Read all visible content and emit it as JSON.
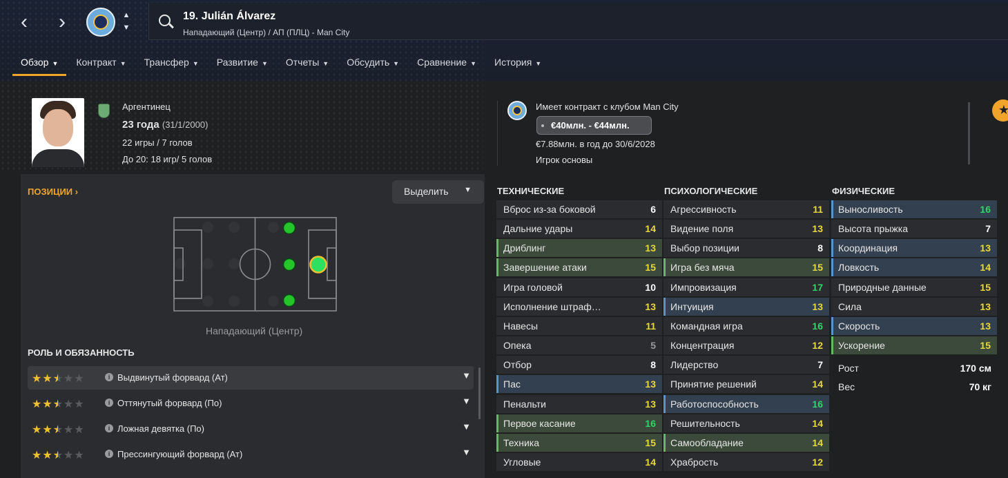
{
  "player": {
    "title": "19. Julián Álvarez",
    "subtitle": "Нападающий (Центр) / АП (ПЛЦ) - Man City"
  },
  "tabs": [
    {
      "label": "Обзор"
    },
    {
      "label": "Контракт"
    },
    {
      "label": "Трансфер"
    },
    {
      "label": "Развитие"
    },
    {
      "label": "Отчеты"
    },
    {
      "label": "Обсудить"
    },
    {
      "label": "Сравнение"
    },
    {
      "label": "История"
    }
  ],
  "info": {
    "nationality": "Аргентинец",
    "age": "23 года",
    "dob": "(31/1/2000)",
    "games": "22 игры / 7 голов",
    "u20": "До 20: 18 игр/ 5 голов"
  },
  "contract": {
    "status": "Имеет контракт с клубом Man City",
    "value": "€40млн. - €44млн.",
    "wage": "€7.88млн. в год до 30/6/2028",
    "role": "Игрок основы"
  },
  "positions": {
    "title": "ПОЗИЦИИ",
    "highlight_label": "Выделить",
    "position_label": "Нападающий (Центр)"
  },
  "roles": {
    "title": "РОЛЬ И ОБЯЗАННОСТЬ",
    "items": [
      {
        "name": "Выдвинутый форвард (Ат)",
        "rating": 2.5
      },
      {
        "name": "Оттянутый форвард (По)",
        "rating": 2.5
      },
      {
        "name": "Ложная девятка (По)",
        "rating": 2.5
      },
      {
        "name": "Прессингующий форвард (Ат)",
        "rating": 2.5
      }
    ]
  },
  "attributes": {
    "technical": {
      "title": "ТЕХНИЧЕСКИЕ",
      "items": [
        {
          "name": "Вброс из-за боковой",
          "value": "6"
        },
        {
          "name": "Дальние удары",
          "value": "14"
        },
        {
          "name": "Дриблинг",
          "value": "13"
        },
        {
          "name": "Завершение атаки",
          "value": "15"
        },
        {
          "name": "Игра головой",
          "value": "10"
        },
        {
          "name": "Исполнение штраф…",
          "value": "13"
        },
        {
          "name": "Навесы",
          "value": "11"
        },
        {
          "name": "Опека",
          "value": "5"
        },
        {
          "name": "Отбор",
          "value": "8"
        },
        {
          "name": "Пас",
          "value": "13"
        },
        {
          "name": "Пенальти",
          "value": "13"
        },
        {
          "name": "Первое касание",
          "value": "16"
        },
        {
          "name": "Техника",
          "value": "15"
        },
        {
          "name": "Угловые",
          "value": "14"
        }
      ]
    },
    "mental": {
      "title": "ПСИХОЛОГИЧЕСКИЕ",
      "items": [
        {
          "name": "Агрессивность",
          "value": "11"
        },
        {
          "name": "Видение поля",
          "value": "13"
        },
        {
          "name": "Выбор позиции",
          "value": "8"
        },
        {
          "name": "Игра без мяча",
          "value": "15"
        },
        {
          "name": "Импровизация",
          "value": "17"
        },
        {
          "name": "Интуиция",
          "value": "13"
        },
        {
          "name": "Командная игра",
          "value": "16"
        },
        {
          "name": "Концентрация",
          "value": "12"
        },
        {
          "name": "Лидерство",
          "value": "7"
        },
        {
          "name": "Принятие решений",
          "value": "14"
        },
        {
          "name": "Работоспособность",
          "value": "16"
        },
        {
          "name": "Решительность",
          "value": "14"
        },
        {
          "name": "Самообладание",
          "value": "14"
        },
        {
          "name": "Храбрость",
          "value": "12"
        }
      ]
    },
    "physical": {
      "title": "ФИЗИЧЕСКИЕ",
      "items": [
        {
          "name": "Выносливость",
          "value": "16"
        },
        {
          "name": "Высота прыжка",
          "value": "7"
        },
        {
          "name": "Координация",
          "value": "13"
        },
        {
          "name": "Ловкость",
          "value": "14"
        },
        {
          "name": "Природные данные",
          "value": "15"
        },
        {
          "name": "Сила",
          "value": "13"
        },
        {
          "name": "Скорость",
          "value": "13"
        },
        {
          "name": "Ускорение",
          "value": "15"
        }
      ]
    },
    "bio": {
      "height_label": "Рост",
      "height_value": "170 см",
      "weight_label": "Вес",
      "weight_value": "70 кг"
    }
  },
  "colors": {
    "accent": "#f0a52a",
    "panel": "#2b2c2f",
    "background": "#1f2022",
    "highlight_green": "#3b4a3a",
    "highlight_blue": "#33404f"
  },
  "icons": [
    "back-arrow-icon",
    "forward-arrow-icon",
    "club-crest-icon",
    "search-icon",
    "flag-icon",
    "info-icon",
    "star-icon",
    "chevron-down-icon"
  ]
}
